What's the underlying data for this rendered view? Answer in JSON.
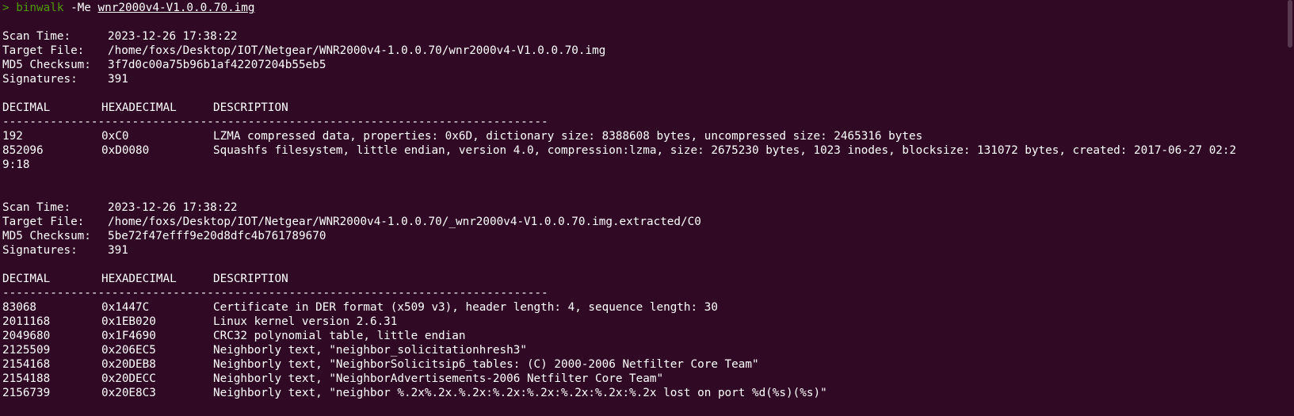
{
  "command": {
    "prompt": ">",
    "program": "binwalk",
    "flags": "-Me",
    "target": "wnr2000v4-V1.0.0.70.img"
  },
  "labels": {
    "scan_time": "Scan Time:",
    "target_file": "Target File:",
    "md5": "MD5 Checksum:",
    "signatures": "Signatures:"
  },
  "table_headers": {
    "decimal": "DECIMAL",
    "hex": "HEXADECIMAL",
    "description": "DESCRIPTION"
  },
  "separator": "--------------------------------------------------------------------------------",
  "scans": [
    {
      "scan_time": "2023-12-26 17:38:22",
      "target_file": "/home/foxs/Desktop/IOT/Netgear/WNR2000v4-1.0.0.70/wnr2000v4-V1.0.0.70.img",
      "md5": "3f7d0c00a75b96b1af42207204b55eb5",
      "signatures": "391",
      "rows": [
        {
          "decimal": "192",
          "hex": "0xC0",
          "description": "LZMA compressed data, properties: 0x6D, dictionary size: 8388608 bytes, uncompressed size: 2465316 bytes",
          "wrap": ""
        },
        {
          "decimal": "852096",
          "hex": "0xD0080",
          "description": "Squashfs filesystem, little endian, version 4.0, compression:lzma, size: 2675230 bytes, 1023 inodes, blocksize: 131072 bytes, created: 2017-06-27 02:2",
          "wrap": "9:18"
        }
      ]
    },
    {
      "scan_time": "2023-12-26 17:38:22",
      "target_file": "/home/foxs/Desktop/IOT/Netgear/WNR2000v4-1.0.0.70/_wnr2000v4-V1.0.0.70.img.extracted/C0",
      "md5": "5be72f47efff9e20d8dfc4b761789670",
      "signatures": "391",
      "rows": [
        {
          "decimal": "83068",
          "hex": "0x1447C",
          "description": "Certificate in DER format (x509 v3), header length: 4, sequence length: 30",
          "wrap": ""
        },
        {
          "decimal": "2011168",
          "hex": "0x1EB020",
          "description": "Linux kernel version 2.6.31",
          "wrap": ""
        },
        {
          "decimal": "2049680",
          "hex": "0x1F4690",
          "description": "CRC32 polynomial table, little endian",
          "wrap": ""
        },
        {
          "decimal": "2125509",
          "hex": "0x206EC5",
          "description": "Neighborly text, \"neighbor_solicitationhresh3\"",
          "wrap": ""
        },
        {
          "decimal": "2154168",
          "hex": "0x20DEB8",
          "description": "Neighborly text, \"NeighborSolicitsip6_tables: (C) 2000-2006 Netfilter Core Team\"",
          "wrap": ""
        },
        {
          "decimal": "2154188",
          "hex": "0x20DECC",
          "description": "Neighborly text, \"NeighborAdvertisements-2006 Netfilter Core Team\"",
          "wrap": ""
        },
        {
          "decimal": "2156739",
          "hex": "0x20E8C3",
          "description": "Neighborly text, \"neighbor %.2x%.2x.%.2x:%.2x:%.2x:%.2x:%.2x:%.2x lost on port %d(%s)(%s)\"",
          "wrap": ""
        }
      ]
    }
  ]
}
